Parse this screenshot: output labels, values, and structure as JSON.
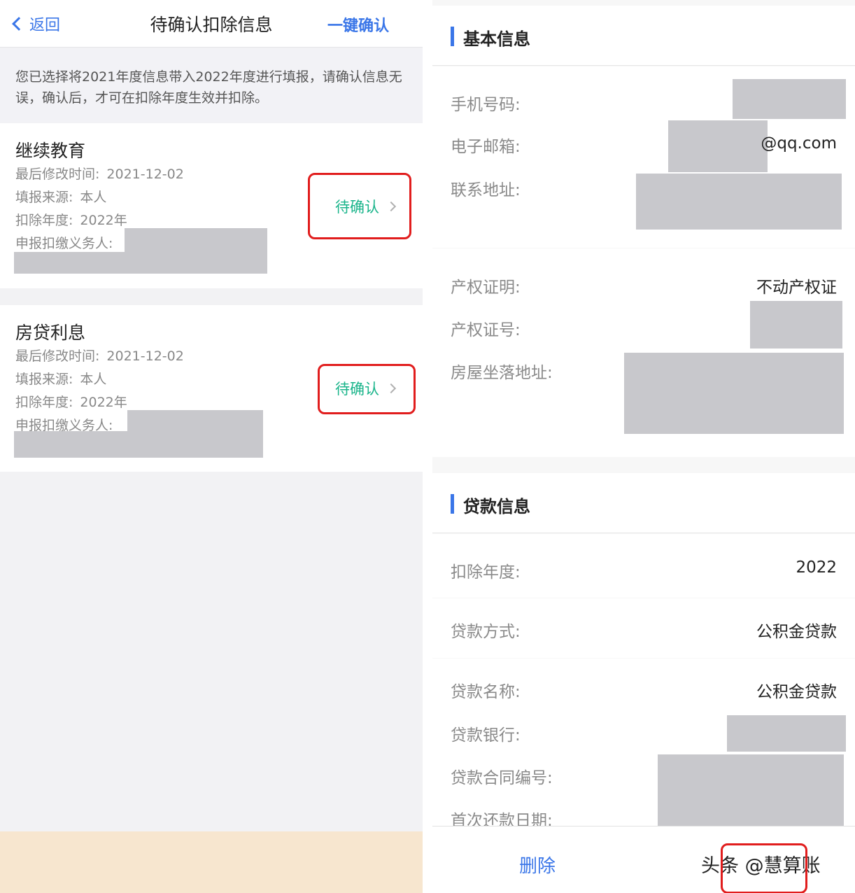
{
  "left": {
    "nav": {
      "back_label": "返回",
      "title": "待确认扣除信息",
      "confirm_all_label": "一键确认"
    },
    "notice": "您已选择将2021年度信息带入2022年度进行填报，请确认信息无误，确认后，才可在扣除年度生效并扣除。",
    "cards": [
      {
        "title": "继续教育",
        "modified_label": "最后修改时间:",
        "modified_value": "2021-12-02",
        "source_label": "填报来源:",
        "source_value": "本人",
        "year_label": "扣除年度:",
        "year_value": "2022年",
        "withholder_label": "申报扣缴义务人:",
        "status": "待确认"
      },
      {
        "title": "房贷利息",
        "modified_label": "最后修改时间:",
        "modified_value": "2021-12-02",
        "source_label": "填报来源:",
        "source_value": "本人",
        "year_label": "扣除年度:",
        "year_value": "2022年",
        "withholder_label": "申报扣缴义务人:",
        "status": "待确认"
      }
    ]
  },
  "right": {
    "basic": {
      "title": "基本信息",
      "phone_label": "手机号码:",
      "email_label": "电子邮箱:",
      "email_suffix": "@qq.com",
      "address_label": "联系地址:",
      "cert_label": "产权证明:",
      "cert_value": "不动产权证",
      "cert_no_label": "产权证号:",
      "house_addr_label": "房屋坐落地址:"
    },
    "loan": {
      "title": "贷款信息",
      "year_label": "扣除年度:",
      "year_value": "2022",
      "method_label": "贷款方式:",
      "method_value": "公积金贷款",
      "name_label": "贷款名称:",
      "name_value": "公积金贷款",
      "bank_label": "贷款银行:",
      "contract_label": "贷款合同编号:",
      "first_repay_label": "首次还款日期:"
    },
    "footer": {
      "delete_label": "删除",
      "watermark": "头条 @慧算账"
    }
  }
}
